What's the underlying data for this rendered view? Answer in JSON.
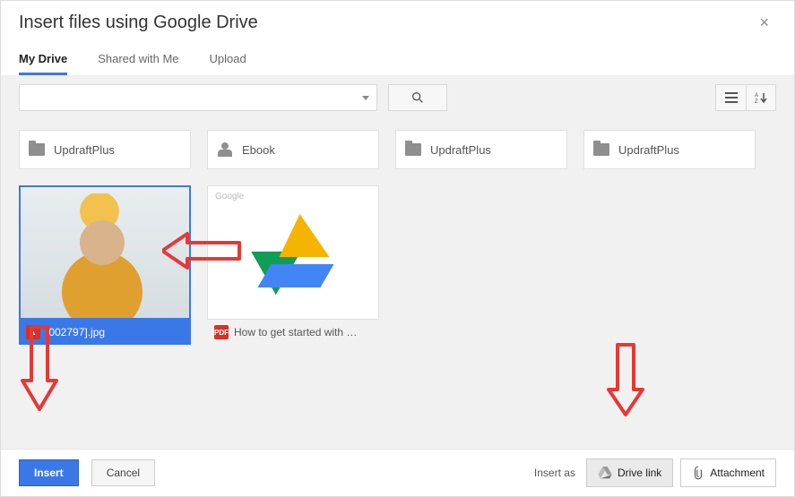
{
  "dialog": {
    "title": "Insert files using Google Drive",
    "close_glyph": "×"
  },
  "tabs": [
    {
      "label": "My Drive",
      "active": true
    },
    {
      "label": "Shared with Me",
      "active": false
    },
    {
      "label": "Upload",
      "active": false
    }
  ],
  "toolbar": {
    "search_placeholder": "",
    "search_value": ""
  },
  "folders": [
    {
      "name": "UpdraftPlus",
      "icon": "folder"
    },
    {
      "name": "Ebook",
      "icon": "shared"
    },
    {
      "name": "UpdraftPlus",
      "icon": "folder"
    },
    {
      "name": "UpdraftPlus",
      "icon": "folder"
    }
  ],
  "files": [
    {
      "name": "[002797].jpg",
      "type": "image",
      "selected": true
    },
    {
      "name": "How to get started with …",
      "type": "pdf",
      "selected": false
    }
  ],
  "footer": {
    "insert_label": "Insert",
    "cancel_label": "Cancel",
    "insert_as_label": "Insert as",
    "drive_link_label": "Drive link",
    "attachment_label": "Attachment"
  },
  "annotations": {
    "color": "#e53935"
  }
}
